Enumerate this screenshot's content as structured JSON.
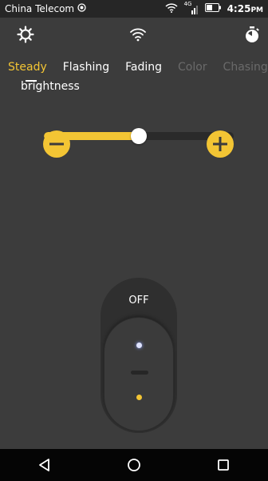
{
  "status_bar": {
    "carrier": "China Telecom",
    "network": "4G",
    "time": "4:25",
    "time_suffix": "PM"
  },
  "toolbar": {
    "left_icon": "settings-icon",
    "center_icon": "wifi-icon",
    "right_icon": "timer-icon"
  },
  "tabs": [
    {
      "label": "Steady",
      "state": "active"
    },
    {
      "label": "Flashing",
      "state": "normal"
    },
    {
      "label": "Fading",
      "state": "normal"
    },
    {
      "label": "Color",
      "state": "disabled"
    },
    {
      "label": "Chasing",
      "state": "disabled"
    }
  ],
  "brightness": {
    "label": "brightness",
    "value_fraction": 0.5
  },
  "power_switch": {
    "label": "OFF"
  },
  "colors": {
    "accent": "#f3c534",
    "background": "#3c3c3c",
    "status_bar": "#262626",
    "nav_bar": "#050505"
  }
}
